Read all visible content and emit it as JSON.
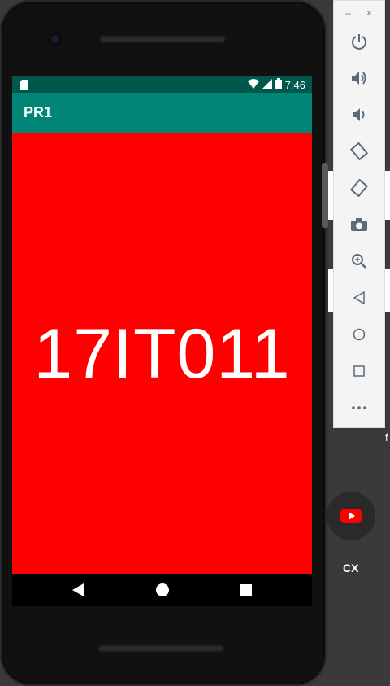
{
  "app": {
    "title": "PR1",
    "main_text": "17IT011"
  },
  "status_bar": {
    "time": "7:46",
    "icons": [
      "sd-card-icon",
      "wifi-icon",
      "signal-icon",
      "battery-icon"
    ]
  },
  "nav_bar": {
    "buttons": [
      "back-icon",
      "home-icon",
      "recents-icon"
    ]
  },
  "emulator_toolbar": {
    "window_controls": {
      "minimize": "–",
      "close": "×"
    },
    "buttons": [
      "power-icon",
      "volume-up-icon",
      "volume-down-icon",
      "rotate-left-icon",
      "rotate-right-icon",
      "camera-icon",
      "zoom-icon",
      "back-icon",
      "home-icon",
      "overview-icon",
      "more-icon"
    ]
  },
  "desktop": {
    "taskbar_label": "CX",
    "peek_text": "f"
  },
  "colors": {
    "status_bar": "#00574b",
    "app_bar": "#008577",
    "content_background": "#ff0000",
    "text": "#ffffff"
  }
}
